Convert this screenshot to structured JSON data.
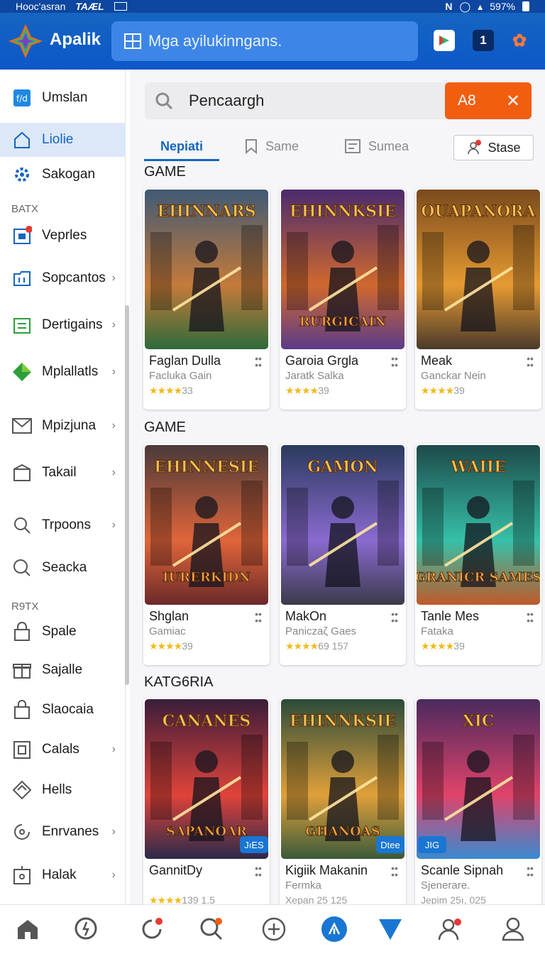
{
  "status_bar": {
    "left_text": "Hooc'asran",
    "carrier": "TAÆL",
    "battery": "597%"
  },
  "app_bar": {
    "brand": "Apalik",
    "search_placeholder": "Mga ayilukinngans.",
    "notification_count": "1"
  },
  "sidebar": {
    "items": [
      {
        "label": "Umslan",
        "icon": "app-grid-icon"
      },
      {
        "label": "Liolie",
        "icon": "home-icon",
        "active": true
      },
      {
        "label": "Sakogan",
        "icon": "gear-cluster-icon"
      }
    ],
    "section1": "BATX",
    "items2": [
      {
        "label": "Veprles",
        "icon": "box-icon"
      },
      {
        "label": "Sopcantos",
        "icon": "folder-icon"
      },
      {
        "label": "Dertigains",
        "icon": "inbox-icon"
      },
      {
        "label": "Mplallatls",
        "icon": "diamond-icon"
      },
      {
        "label": "Mpizjuna",
        "icon": "mail-icon"
      },
      {
        "label": "Takail",
        "icon": "package-icon"
      },
      {
        "label": "Trpoons",
        "icon": "search-icon"
      },
      {
        "label": "Seacka",
        "icon": "search-icon"
      }
    ],
    "section2": "R9TX",
    "items3": [
      {
        "label": "Spale",
        "icon": "lock-icon"
      },
      {
        "label": "Sajalle",
        "icon": "gift-icon"
      },
      {
        "label": "Slaocaia",
        "icon": "bag-icon"
      },
      {
        "label": "Calals",
        "icon": "calendar-icon"
      },
      {
        "label": "Hells",
        "icon": "tag-icon"
      },
      {
        "label": "Enrvanes",
        "icon": "refresh-icon"
      },
      {
        "label": "Halak",
        "icon": "device-icon"
      }
    ]
  },
  "main": {
    "search_value": "Pencaargh",
    "search_button": "A8",
    "tabs": [
      {
        "label": "Nepiati",
        "active": true
      },
      {
        "label": "Same"
      },
      {
        "label": "Sumea"
      }
    ],
    "stase_button": "Stase",
    "sections": [
      {
        "title": "GAME",
        "cards": [
          {
            "name": "Faglan Dulla",
            "sub": "Facluka Gain",
            "rating": "★★★★",
            "count": "33",
            "art_title": "EHINNARS",
            "art_sub": "",
            "palette": [
              "#3f5a75",
              "#c57a3a",
              "#2e6a3a"
            ]
          },
          {
            "name": "Garoia Grgla",
            "sub": "Jaratk Salka",
            "rating": "★★★★",
            "count": "39",
            "art_title": "EHINNKSIE",
            "art_sub": "RURGICAIN",
            "palette": [
              "#4a2b6e",
              "#d0682e",
              "#5b3b8a"
            ]
          },
          {
            "name": "Meak",
            "sub": "Ganckar Nein",
            "rating": "★★★★",
            "count": "39",
            "art_title": "OUAPANORA",
            "art_sub": "",
            "palette": [
              "#7a4a1d",
              "#e69a32",
              "#4a3a2a"
            ]
          }
        ]
      },
      {
        "title": "GAME",
        "cards": [
          {
            "name": "Shglan",
            "sub": "Gamiac",
            "rating": "★★★★",
            "count": "39",
            "art_title": "EHINNESIE",
            "art_sub": "IURERKIDN",
            "palette": [
              "#4a3a3a",
              "#e0653a",
              "#6a2a2a"
            ]
          },
          {
            "name": "MakOn",
            "sub": "Paniczaζ Gaes",
            "rating": "★★★★",
            "count": "69   157",
            "art_title": "GAMON",
            "art_sub": "",
            "palette": [
              "#2a3a5e",
              "#8a6ad0",
              "#3a3a4a"
            ]
          },
          {
            "name": "Tanle Mes",
            "sub": "Fataka",
            "rating": "★★★★",
            "count": "39",
            "art_title": "WAIIE",
            "art_sub": "GRANICR SAMES",
            "palette": [
              "#1d4a4a",
              "#36c0a8",
              "#c05a2a"
            ]
          }
        ]
      },
      {
        "title": "KATG6RIA",
        "cards": [
          {
            "name": "GannitDy",
            "sub": "",
            "rating": "★★★★",
            "count": "139   1.5",
            "art_title": "CANANES",
            "art_sub": "SAPANOAR",
            "palette": [
              "#3a1d3a",
              "#e0433a",
              "#2a2a4a"
            ],
            "badge": "JıES"
          },
          {
            "name": "Kigiik Makanin",
            "sub": "Fermka",
            "rating": "",
            "count": "Xepan 25   125",
            "art_title": "EHINNKSIE",
            "art_sub": "GHANOAS",
            "palette": [
              "#2a4a3a",
              "#e0a03a",
              "#3a5a3a"
            ],
            "badge": "Dtee"
          },
          {
            "name": "Scanle Sipnah",
            "sub": "Sjenerare.",
            "rating": "",
            "count": "Jepim 25ı,  025",
            "art_title": "XIC",
            "art_sub": "",
            "palette": [
              "#4a2a5e",
              "#e0436a",
              "#3a8ad0"
            ],
            "badge": "JIG"
          }
        ]
      }
    ]
  },
  "bottom_nav": [
    {
      "name": "home-icon"
    },
    {
      "name": "activity-icon"
    },
    {
      "name": "refresh-icon"
    },
    {
      "name": "search-icon"
    },
    {
      "name": "add-icon"
    },
    {
      "name": "compass-icon"
    },
    {
      "name": "download-icon"
    },
    {
      "name": "friends-icon"
    },
    {
      "name": "profile-icon"
    }
  ],
  "colors": {
    "primary": "#1565c0",
    "accent": "#f25e10",
    "star": "#f1b91b"
  }
}
